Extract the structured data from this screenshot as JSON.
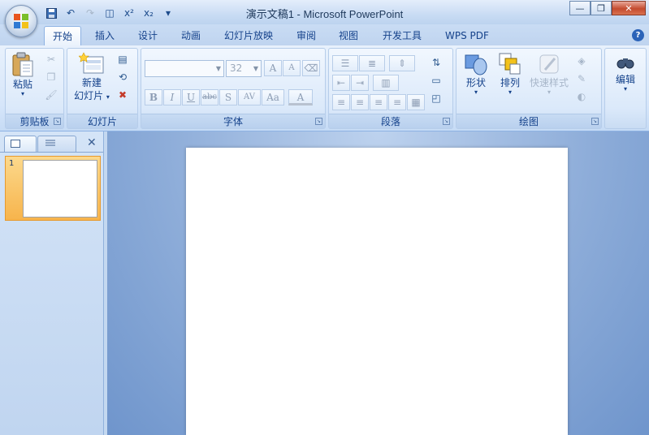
{
  "window": {
    "title": "演示文稿1 - Microsoft PowerPoint",
    "minimize_glyph": "—",
    "restore_glyph": "❐",
    "close_glyph": "✕"
  },
  "qat": {
    "buttons": [
      "save-icon",
      "undo-icon",
      "redo-icon",
      "print-preview-icon",
      "superscript-icon",
      "subscript-icon",
      "customize-icon"
    ],
    "glyphs": [
      "▪",
      "↶",
      "↷",
      "◫",
      "x²",
      "x₂",
      "▾"
    ]
  },
  "tabs": [
    "开始",
    "插入",
    "设计",
    "动画",
    "幻灯片放映",
    "审阅",
    "视图",
    "开发工具",
    "WPS PDF"
  ],
  "active_tab": "开始",
  "help": "?",
  "ribbon": {
    "clipboard": {
      "label": "剪贴板",
      "paste_label": "粘贴",
      "paste_arrow": "▾"
    },
    "slides": {
      "label": "幻灯片",
      "new_slide_line1": "新建",
      "new_slide_line2": "幻灯片",
      "new_slide_arrow": "▾"
    },
    "font": {
      "label": "字体",
      "font_name_value": "",
      "font_size_value": "32",
      "grow": "A",
      "shrink": "A",
      "bold": "B",
      "italic": "I",
      "underline": "U",
      "strike": "abc",
      "shadow": "S",
      "spacing": "AV",
      "case": "Aa",
      "color": "A"
    },
    "paragraph": {
      "label": "段落"
    },
    "drawing": {
      "label": "绘图",
      "shapes_label": "形状",
      "arrange_label": "排列",
      "quick_styles_label": "快速样式"
    },
    "editing": {
      "label": "编辑"
    }
  },
  "slides_pane": {
    "slide_number": "1",
    "close_glyph": "✕"
  },
  "colors": {
    "accent": "#15428b",
    "selected_thumb": "#f7b44c",
    "work_bg": "#8eadd9"
  }
}
